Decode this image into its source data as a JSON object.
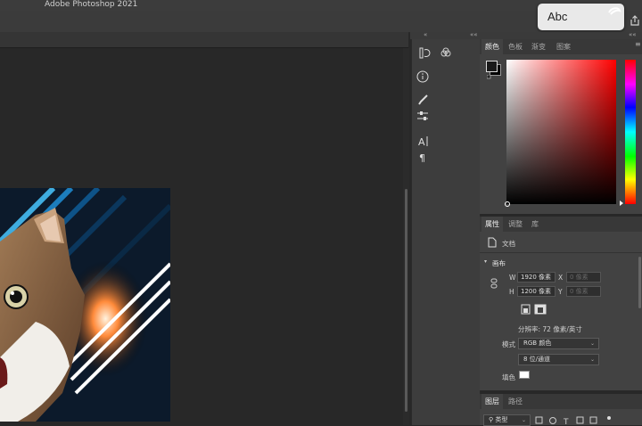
{
  "app": {
    "title": "Adobe Photoshop 2021"
  },
  "tooltip": {
    "text": "Abc"
  },
  "color_panel": {
    "tabs": [
      "颜色",
      "色板",
      "渐变",
      "图案"
    ],
    "active_tab": 0,
    "foreground": "#1a1a1a",
    "background": "#000000",
    "hue": "#ff1a1a"
  },
  "properties_panel": {
    "tabs": [
      "属性",
      "调整",
      "库"
    ],
    "active_tab": 0,
    "doc_label": "文档",
    "section_title": "画布",
    "width_label": "W",
    "width_value": "1920 像素",
    "height_label": "H",
    "height_value": "1200 像素",
    "x_label": "X",
    "x_placeholder": "0 像素",
    "y_label": "Y",
    "y_placeholder": "0 像素",
    "resolution": "分辨率: 72 像素/英寸",
    "mode_label": "模式",
    "mode_value": "RGB 颜色",
    "depth_value": "8 位/通道",
    "fill_label": "填色"
  },
  "layers_panel": {
    "tabs": [
      "图层",
      "路径"
    ],
    "active_tab": 0,
    "filter_value": "类型"
  },
  "collapse_glyphs": {
    "left": "«",
    "mid": "««",
    "right": "««"
  }
}
